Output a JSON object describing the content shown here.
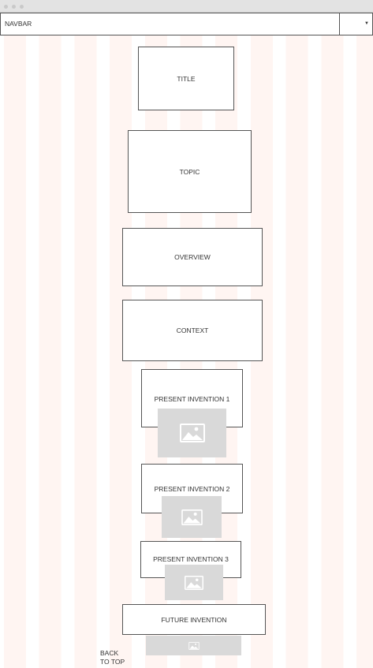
{
  "navbar": {
    "label": "NAVBAR"
  },
  "sections": {
    "title": "TITLE",
    "topic": "TOPIC",
    "overview": "OVERVIEW",
    "context": "CONTEXT",
    "present_1": "PRESENT INVENTION 1",
    "present_2": "PRESENT INVENTION 2",
    "present_3": "PRESENT INVENTION 3",
    "future": "FUTURE INVENTION"
  },
  "footer": {
    "back_line1": "BACK",
    "back_line2": "TO TOP"
  },
  "icons": {
    "placeholder": "image-icon",
    "dropdown": "caret-down-icon"
  },
  "colors": {
    "grid_column": "#fff5f2",
    "image_placeholder": "#d9d9d9",
    "border": "#555555"
  }
}
